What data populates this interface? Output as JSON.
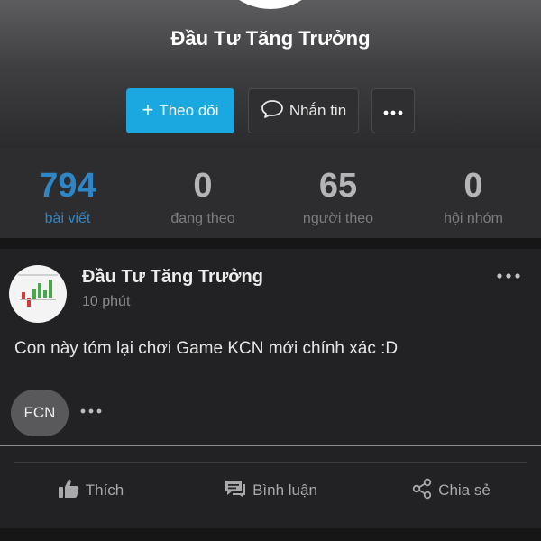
{
  "profile": {
    "name": "Đầu Tư Tăng Trưởng"
  },
  "buttons": {
    "follow_label": "Theo dõi",
    "message_label": "Nhắn tin"
  },
  "stats": [
    {
      "value": "794",
      "label": "bài viết"
    },
    {
      "value": "0",
      "label": "đang theo"
    },
    {
      "value": "65",
      "label": "người theo"
    },
    {
      "value": "0",
      "label": "hội nhóm"
    }
  ],
  "post": {
    "author": "Đầu Tư Tăng Trưởng",
    "time": "10 phút",
    "content": "Con này tóm lại chơi Game KCN mới chính xác :D",
    "tags": [
      "FCN"
    ],
    "actions": {
      "like": "Thích",
      "comment": "Bình luận",
      "share": "Chia sẻ"
    }
  },
  "colors": {
    "accent": "#1ba8e0",
    "active_stat": "#2e86c6"
  },
  "icons": [
    "plus-icon",
    "chat-bubble-icon",
    "more-horizontal-icon",
    "thumbs-up-icon",
    "comment-icon",
    "share-icon"
  ]
}
